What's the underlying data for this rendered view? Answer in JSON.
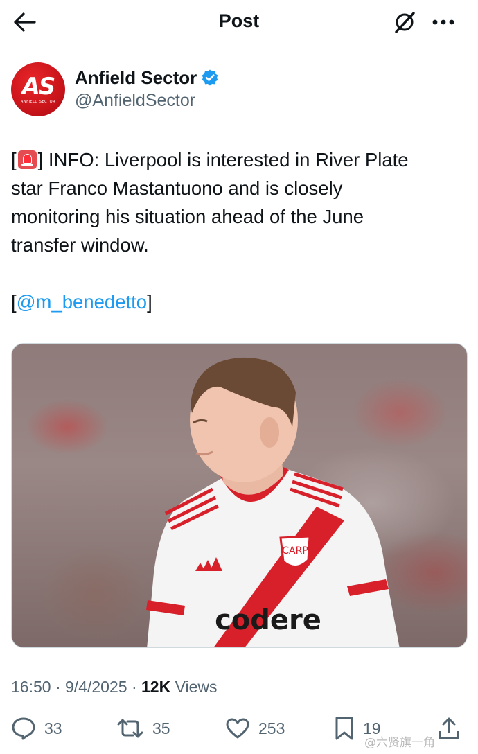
{
  "header": {
    "title": "Post",
    "back_icon": "arrow-left-icon",
    "grok_icon": "grok-icon",
    "more_icon": "more-dots-icon"
  },
  "author": {
    "avatar_text": "AS",
    "avatar_subtext": "ANFIELD SECTOR",
    "name": "Anfield Sector",
    "handle": "@AnfieldSector",
    "verified": true,
    "avatar_color": "#c9141a",
    "verified_color": "#1d9bf0"
  },
  "tweet": {
    "line1_open": "[",
    "line1_rest": "] INFO: Liverpool is interested in River Plate",
    "line2": "star Franco Mastantuono and is closely",
    "line3": "monitoring his situation ahead of the June",
    "line4": "transfer window.",
    "source_open": "[",
    "mention": "@m_benedetto",
    "source_close": "]",
    "emoji": "police-car-light"
  },
  "media": {
    "kit_sponsor": "codere",
    "description_icon": "player-photo"
  },
  "meta": {
    "time": "16:50",
    "date": "9/4/2025",
    "views_count": "12K",
    "views_label": "Views",
    "sep": "·"
  },
  "actions": {
    "replies": "33",
    "reposts": "35",
    "likes": "253",
    "bookmarks": "19"
  },
  "watermark": "@六贤旗一角",
  "colors": {
    "accent": "#1d9bf0",
    "text": "#0f1419",
    "muted": "#536471"
  }
}
